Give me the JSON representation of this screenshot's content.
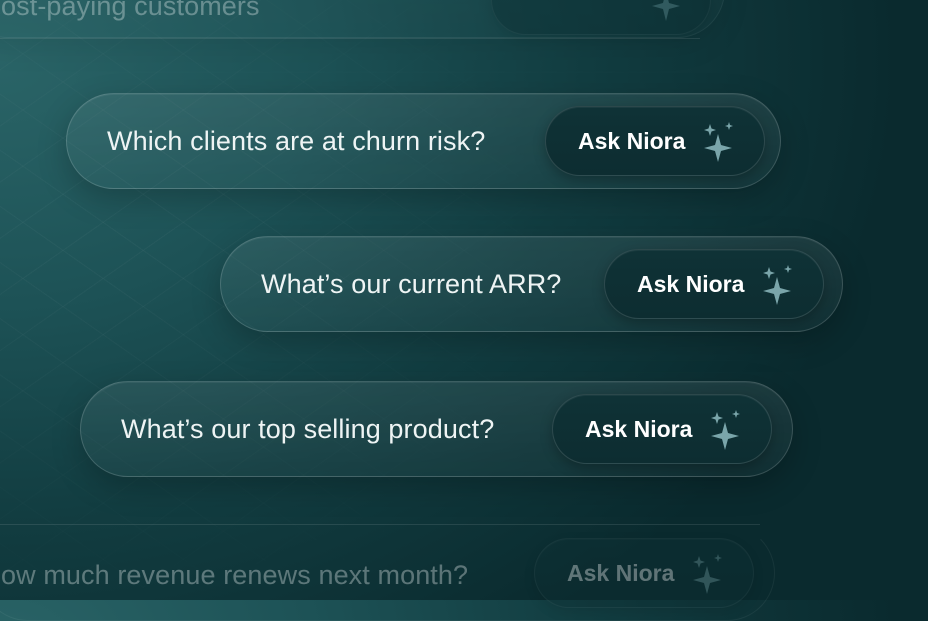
{
  "cta_label": "Ask Niora",
  "prompts": [
    {
      "question": "Which clients are at churn risk?"
    },
    {
      "question": "What’s our current ARR?"
    },
    {
      "question": "What’s our top selling product?"
    },
    {
      "question": "ow much revenue renews next month?"
    }
  ],
  "top_partial_text": "ost-paying customers",
  "icon": "sparkle-icon",
  "colors": {
    "background": "#123d41",
    "pill_text": "#eef4f4",
    "button_bg": "#0f3236",
    "sparkle": "#6f9aa0"
  }
}
